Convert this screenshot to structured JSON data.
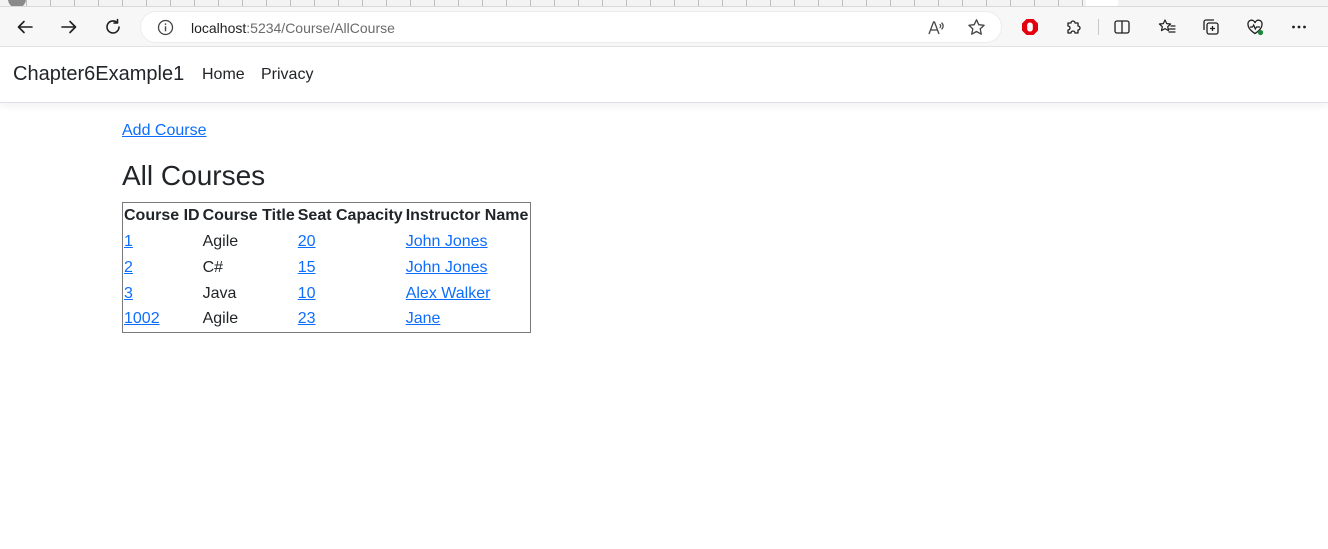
{
  "browser": {
    "url_host": "localhost",
    "url_path": ":5234/Course/AllCourse",
    "read_aloud_label": "A»"
  },
  "navbar": {
    "brand": "Chapter6Example1",
    "links": [
      "Home",
      "Privacy"
    ]
  },
  "page": {
    "add_link": "Add Course",
    "heading": "All Courses"
  },
  "table": {
    "headers": [
      "Course ID",
      "Course Title",
      "Seat Capacity",
      "Instructor Name"
    ],
    "rows": [
      [
        "1",
        "Agile",
        "20",
        "John Jones"
      ],
      [
        "2",
        "C#",
        "15",
        "John Jones"
      ],
      [
        "3",
        "Java",
        "10",
        "Alex Walker"
      ],
      [
        "1002",
        "Agile",
        "23",
        "Jane"
      ]
    ]
  },
  "colors": {
    "link": "#0d6efd",
    "text": "#212529",
    "extension_red": "#e3000f"
  }
}
